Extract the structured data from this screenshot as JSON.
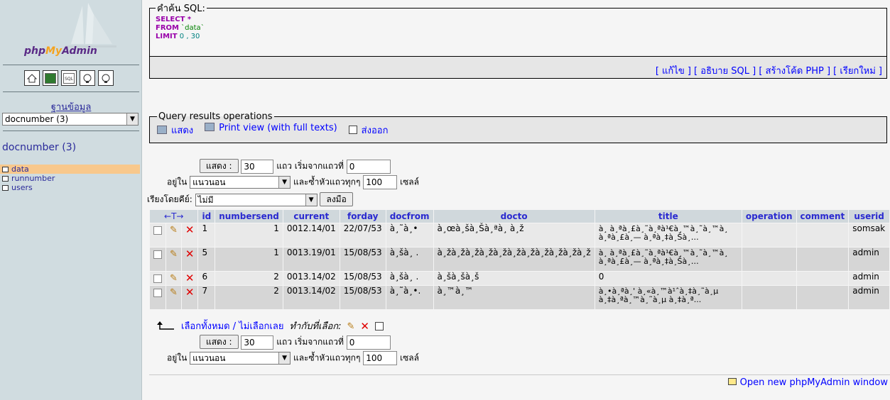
{
  "left": {
    "logo": {
      "part1": "php",
      "part2": "My",
      "part3": "Admin"
    },
    "icons": [
      "home-icon",
      "database-icon",
      "sql-icon",
      "docs-icon",
      "help-icon"
    ],
    "db_label": "ฐานข้อมูล",
    "db_selected": "docnumber (3)",
    "db_title": "docnumber (3)",
    "tables": [
      "data",
      "runnumber",
      "users"
    ],
    "active_table": "data"
  },
  "sql": {
    "legend": "คำค้น SQL:",
    "line1_kw": "SELECT",
    "line1_rest": " *",
    "line2_kw": "FROM",
    "line2_str": " `data`",
    "line3_kw": "LIMIT",
    "line3_num": " 0 , 30",
    "links": "[ แก้ไข ] [ อธิบาย SQL ] [ สร้างโค้ด PHP ] [ เรียกใหม่ ]"
  },
  "qro": {
    "legend": "Query results operations",
    "show": "แสดง",
    "print_view": "Print view (with full texts)",
    "export": "ส่งออก"
  },
  "nav": {
    "show_button": "แสดง :",
    "rows": "30",
    "rows_label": "แถว เริ่มจากแถวที่",
    "start": "0",
    "in_label": "อยู่ใน",
    "mode": "แนวนอน",
    "repeat_label": "และซ้ำหัวแถวทุกๆ",
    "repeat": "100",
    "cells": "เซลล์",
    "sort_label": "เรียงโดยคีย์:",
    "sort_value": "ไม่มี",
    "go_button": "ลงมือ"
  },
  "table": {
    "arrows": "←T→",
    "headers": [
      "id",
      "numbersend",
      "current",
      "forday",
      "docfrom",
      "docto",
      "title",
      "operation",
      "comment",
      "userid"
    ],
    "rows": [
      {
        "id": "1",
        "numbersend": "1",
        "current": "0012.14/01",
        "forday": "22/07/53",
        "docfrom": "à¸˜à¸•",
        "docto": "à¸œà¸šà¸Šà¸ªà¸ à¸ž",
        "title": "à¸ à¸ªà¸£à¸˜à¸ªà¹€à¸™à¸˜à¸™à¸ à¸ªà¸£à¸— à¸ªà¸‡à¸Šà¸…",
        "operation": "",
        "comment": "",
        "userid": "somsak"
      },
      {
        "id": "5",
        "numbersend": "1",
        "current": "0013.19/01",
        "forday": "15/08/53",
        "docfrom": "à¸šà¸ .",
        "docto": "à¸žà¸žà¸žà¸žà¸žà¸žà¸žà¸žà¸žà¸žà¸ž",
        "title": "à¸ à¸ªà¸£à¸˜à¸ªà¹€à¸™à¸˜à¸™à¸ à¸ªà¸£à¸— à¸ªà¸‡à¸Šà¸…",
        "operation": "",
        "comment": "",
        "userid": "admin"
      },
      {
        "id": "6",
        "numbersend": "2",
        "current": "0013.14/02",
        "forday": "15/08/53",
        "docfrom": "à¸šà¸ .",
        "docto": "à¸šà¸šà¸š",
        "title": "0",
        "operation": "",
        "comment": "",
        "userid": "admin"
      },
      {
        "id": "7",
        "numbersend": "2",
        "current": "0013.14/02",
        "forday": "15/08/53",
        "docfrom": "à¸˜à¸•.",
        "docto": "à¸™à¸™",
        "title": "à¸•à¸ªà¸' à¸«à¸™à¹ˆà¸‡à¸˜à¸µ à¸‡à¸ªà¸™à¸˜à¸µ à¸‡à¸ª...",
        "operation": "",
        "comment": "",
        "userid": "admin"
      }
    ]
  },
  "bulk": {
    "select_all": "เลือกทั้งหมด / ไม่เลือกเลย",
    "with_selected": "ทำกับที่เลือก:"
  },
  "footer": {
    "new_window": "Open new phpMyAdmin window"
  }
}
